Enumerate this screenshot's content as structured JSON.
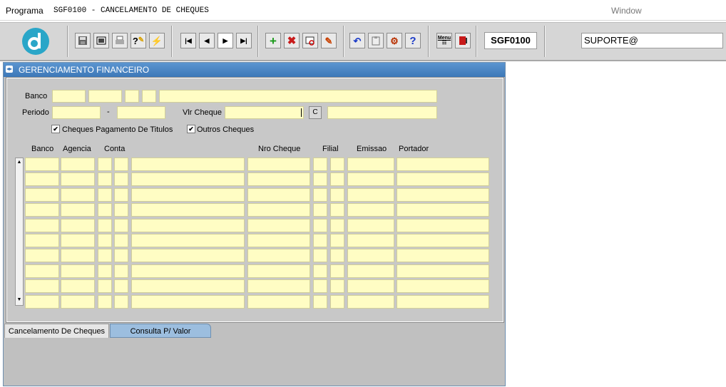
{
  "menubar": {
    "programa_label": "Programa",
    "title": "SGF0100 - CANCELAMENTO DE CHEQUES",
    "window_label": "Window"
  },
  "toolbar": {
    "form_code": "SGF0100",
    "user_field": "SUPORTE@",
    "menu_button_label": "Menu"
  },
  "window": {
    "title": "GERENCIAMENTO FINANCEIRO"
  },
  "form": {
    "banco_label": "Banco",
    "periodo_label": "Periodo",
    "periodo_separator": "-",
    "vlr_cheque_label": "Vlr Cheque",
    "c_button_label": "C",
    "chk_titulos_label": "Cheques Pagamento De Titulos",
    "chk_titulos_checked": true,
    "chk_outros_label": "Outros Cheques",
    "chk_outros_checked": true
  },
  "grid": {
    "columns": [
      "Banco",
      "Agencia",
      "Conta",
      "Nro Cheque",
      "Filial",
      "Emissao",
      "Portador"
    ],
    "row_count": 10
  },
  "tabs": [
    {
      "label": "Cancelamento De Cheques",
      "active": true
    },
    {
      "label": "Consulta P/ Valor",
      "active": false
    }
  ],
  "colors": {
    "field_bg": "#fffdc4",
    "window_title": "#4a87c7",
    "toolbar_bg": "#d6d6d6"
  }
}
